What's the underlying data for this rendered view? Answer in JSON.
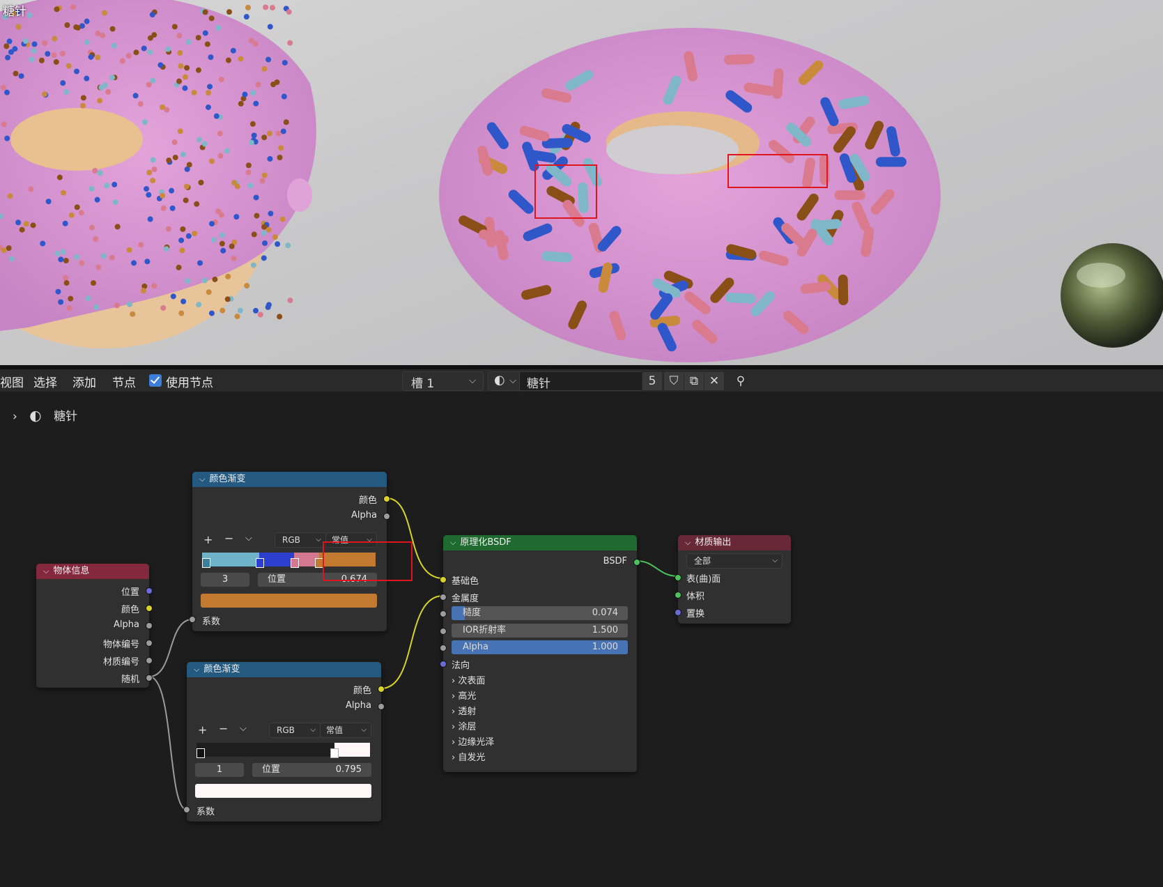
{
  "viewport": {
    "title": "糖针"
  },
  "header": {
    "menu": [
      "视图",
      "选择",
      "添加",
      "节点"
    ],
    "use_nodes_label": "使用节点",
    "slot": "槽 1",
    "material_name": "糖针",
    "users_count": "5"
  },
  "breadcrumb": {
    "label": "糖针"
  },
  "nodes": {
    "object_info": {
      "title": "物体信息",
      "outputs": [
        "位置",
        "颜色",
        "Alpha",
        "物体编号",
        "材质编号",
        "随机"
      ]
    },
    "ramp1": {
      "title": "颜色渐变",
      "out_color": "颜色",
      "out_alpha": "Alpha",
      "mode": "RGB",
      "interp": "常值",
      "stop_index": "3",
      "pos_label": "位置",
      "pos_value": "0.674",
      "in_fac": "系数",
      "stop_color": "#c37a30",
      "stop_positions": [
        0.0,
        0.33,
        0.53,
        0.674
      ]
    },
    "ramp2": {
      "title": "颜色渐变",
      "out_color": "颜色",
      "out_alpha": "Alpha",
      "mode": "RGB",
      "interp": "常值",
      "stop_index": "1",
      "pos_label": "位置",
      "pos_value": "0.795",
      "in_fac": "系数",
      "stop_color": "#fff6f8",
      "stop_positions": [
        0.0,
        0.795
      ]
    },
    "bsdf": {
      "title": "原理化BSDF",
      "out": "BSDF",
      "base_color": "基础色",
      "metallic": "金属度",
      "roughness_label": "糙度",
      "roughness": "0.074",
      "ior_label": "IOR折射率",
      "ior": "1.500",
      "alpha_label": "Alpha",
      "alpha": "1.000",
      "normal": "法向",
      "panels": [
        "次表面",
        "高光",
        "透射",
        "涂层",
        "边缘光泽",
        "自发光"
      ]
    },
    "output": {
      "title": "材质输出",
      "target": "全部",
      "inputs": [
        "表(曲)面",
        "体积",
        "置换"
      ]
    }
  }
}
